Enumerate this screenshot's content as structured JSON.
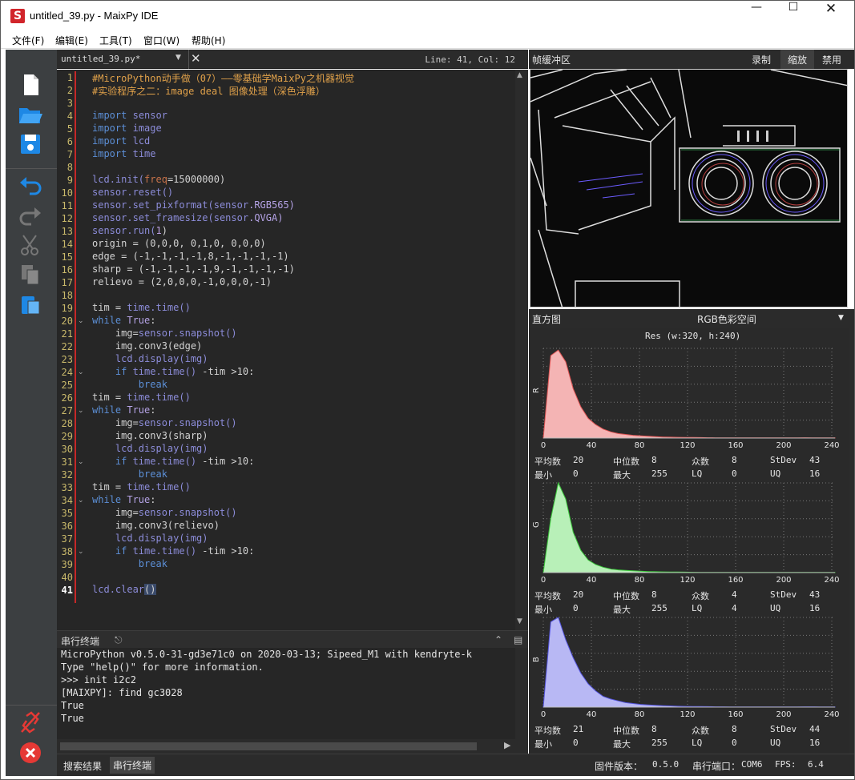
{
  "window": {
    "title": "untitled_39.py - MaixPy IDE",
    "app_icon": "S"
  },
  "menu": [
    "文件(F)",
    "编辑(E)",
    "工具(T)",
    "窗口(W)",
    "帮助(H)"
  ],
  "editor": {
    "filename": "untitled_39.py*",
    "cursor": "Line: 41, Col: 12"
  },
  "code_lines": [
    "1",
    "2",
    "3",
    "4",
    "5",
    "6",
    "7",
    "8",
    "9",
    "10",
    "11",
    "12",
    "13",
    "14",
    "15",
    "16",
    "17",
    "18",
    "19",
    "20",
    "21",
    "22",
    "23",
    "24",
    "25",
    "26",
    "27",
    "28",
    "29",
    "30",
    "31",
    "32",
    "33",
    "34",
    "35",
    "36",
    "37",
    "38",
    "39",
    "40",
    "41"
  ],
  "code": {
    "l1": "#MicroPython动手做（07）——零基础学MaixPy之机器视觉",
    "l2": "#实验程序之二：image deal 图像处理（深色浮雕）",
    "imp": "import",
    "m_sensor": "sensor",
    "m_image": "image",
    "m_lcd": "lcd",
    "m_time": "time",
    "l9a": "lcd",
    "l9b": ".init(",
    "l9c": "freq",
    "l9d": "=15000000)",
    "l10a": "sensor",
    "l10b": ".reset()",
    "l11a": "sensor",
    "l11b": ".set_pixformat(",
    "l11c": "sensor",
    ".": ".",
    "l11d": ".RGB565)",
    "l12a": "sensor",
    "l12b": ".set_framesize(",
    "l12c": "sensor",
    "l12d": ".QVGA)",
    "l13a": "sensor",
    "l13b": ".run(",
    "l13c": "1",
    "l13d": ")",
    "l14": "origin = (0,0,0, 0,1,0, 0,0,0)",
    "l15": "edge = (-1,-1,-1,-1,8,-1,-1,-1,-1)",
    "l16": "sharp = (-1,-1,-1,-1,9,-1,-1,-1,-1)",
    "l17": "relievo = (2,0,0,0,-1,0,0,0,-1)",
    "tim": "tim = ",
    "time_time": "time.time()",
    "while": "while ",
    "true": "True",
    ":": ":",
    "snap_a": "    img=",
    "snap_b": "sensor.snapshot()",
    "conv_edge": "    img.conv3(edge)",
    "conv_sharp": "    img.conv3(sharp)",
    "conv_relievo": "    img.conv3(relievo)",
    "disp_a": "    lcd",
    "disp_b": ".display(img)",
    "if_a": "    if ",
    "if_b": "time.time()",
    "if_c": " -tim >10:",
    "brk": "        break",
    "clear_a": "lcd",
    "clear_b": ".clear",
    "clear_c": "()"
  },
  "terminal": {
    "title": "串行终端",
    "lines": [
      "MicroPython v0.5.0-31-gd3e71c0 on 2020-03-13; Sipeed_M1 with kendryte-k",
      "Type \"help()\" for more information.",
      ">>> init i2c2",
      "[MAIXPY]: find gc3028",
      "True",
      "True"
    ]
  },
  "bottom_tabs": [
    "搜索结果",
    "串行终端"
  ],
  "status": {
    "firmware_label": "固件版本：",
    "firmware": "0.5.0",
    "port_label": "串行端口：",
    "port": "COM6",
    "fps_label": "FPS:",
    "fps": "6.4"
  },
  "framebuffer": {
    "title": "帧缓冲区",
    "record": "录制",
    "zoom": "缩放",
    "disable": "禁用"
  },
  "histogram": {
    "title": "直方图",
    "colorspace": "RGB色彩空间",
    "res": "Res (w:320, h:240)",
    "xticks": [
      "0",
      "40",
      "80",
      "120",
      "160",
      "200",
      "240"
    ],
    "labels": {
      "mean": "平均数",
      "median": "中位数",
      "mode": "众数",
      "stdev": "StDev",
      "min": "最小",
      "max": "最大",
      "lq": "LQ",
      "uq": "UQ"
    },
    "channels": [
      {
        "name": "R",
        "color": "#f4b4b4",
        "stroke": "#e05555",
        "mean": "20",
        "median": "8",
        "mode": "8",
        "stdev": "43",
        "min": "0",
        "max": "255",
        "lq": "0",
        "uq": "16"
      },
      {
        "name": "G",
        "color": "#b8f0b8",
        "stroke": "#3cc83c",
        "mean": "20",
        "median": "8",
        "mode": "4",
        "stdev": "43",
        "min": "0",
        "max": "255",
        "lq": "4",
        "uq": "16"
      },
      {
        "name": "B",
        "color": "#b8b8f4",
        "stroke": "#5555e0",
        "mean": "21",
        "median": "8",
        "mode": "8",
        "stdev": "44",
        "min": "0",
        "max": "255",
        "lq": "0",
        "uq": "16"
      }
    ]
  },
  "colors": {
    "accent": "#d1252b",
    "editor_bg": "#262626",
    "comment": "#e0a14a",
    "keyword": "#5c8fd6"
  }
}
